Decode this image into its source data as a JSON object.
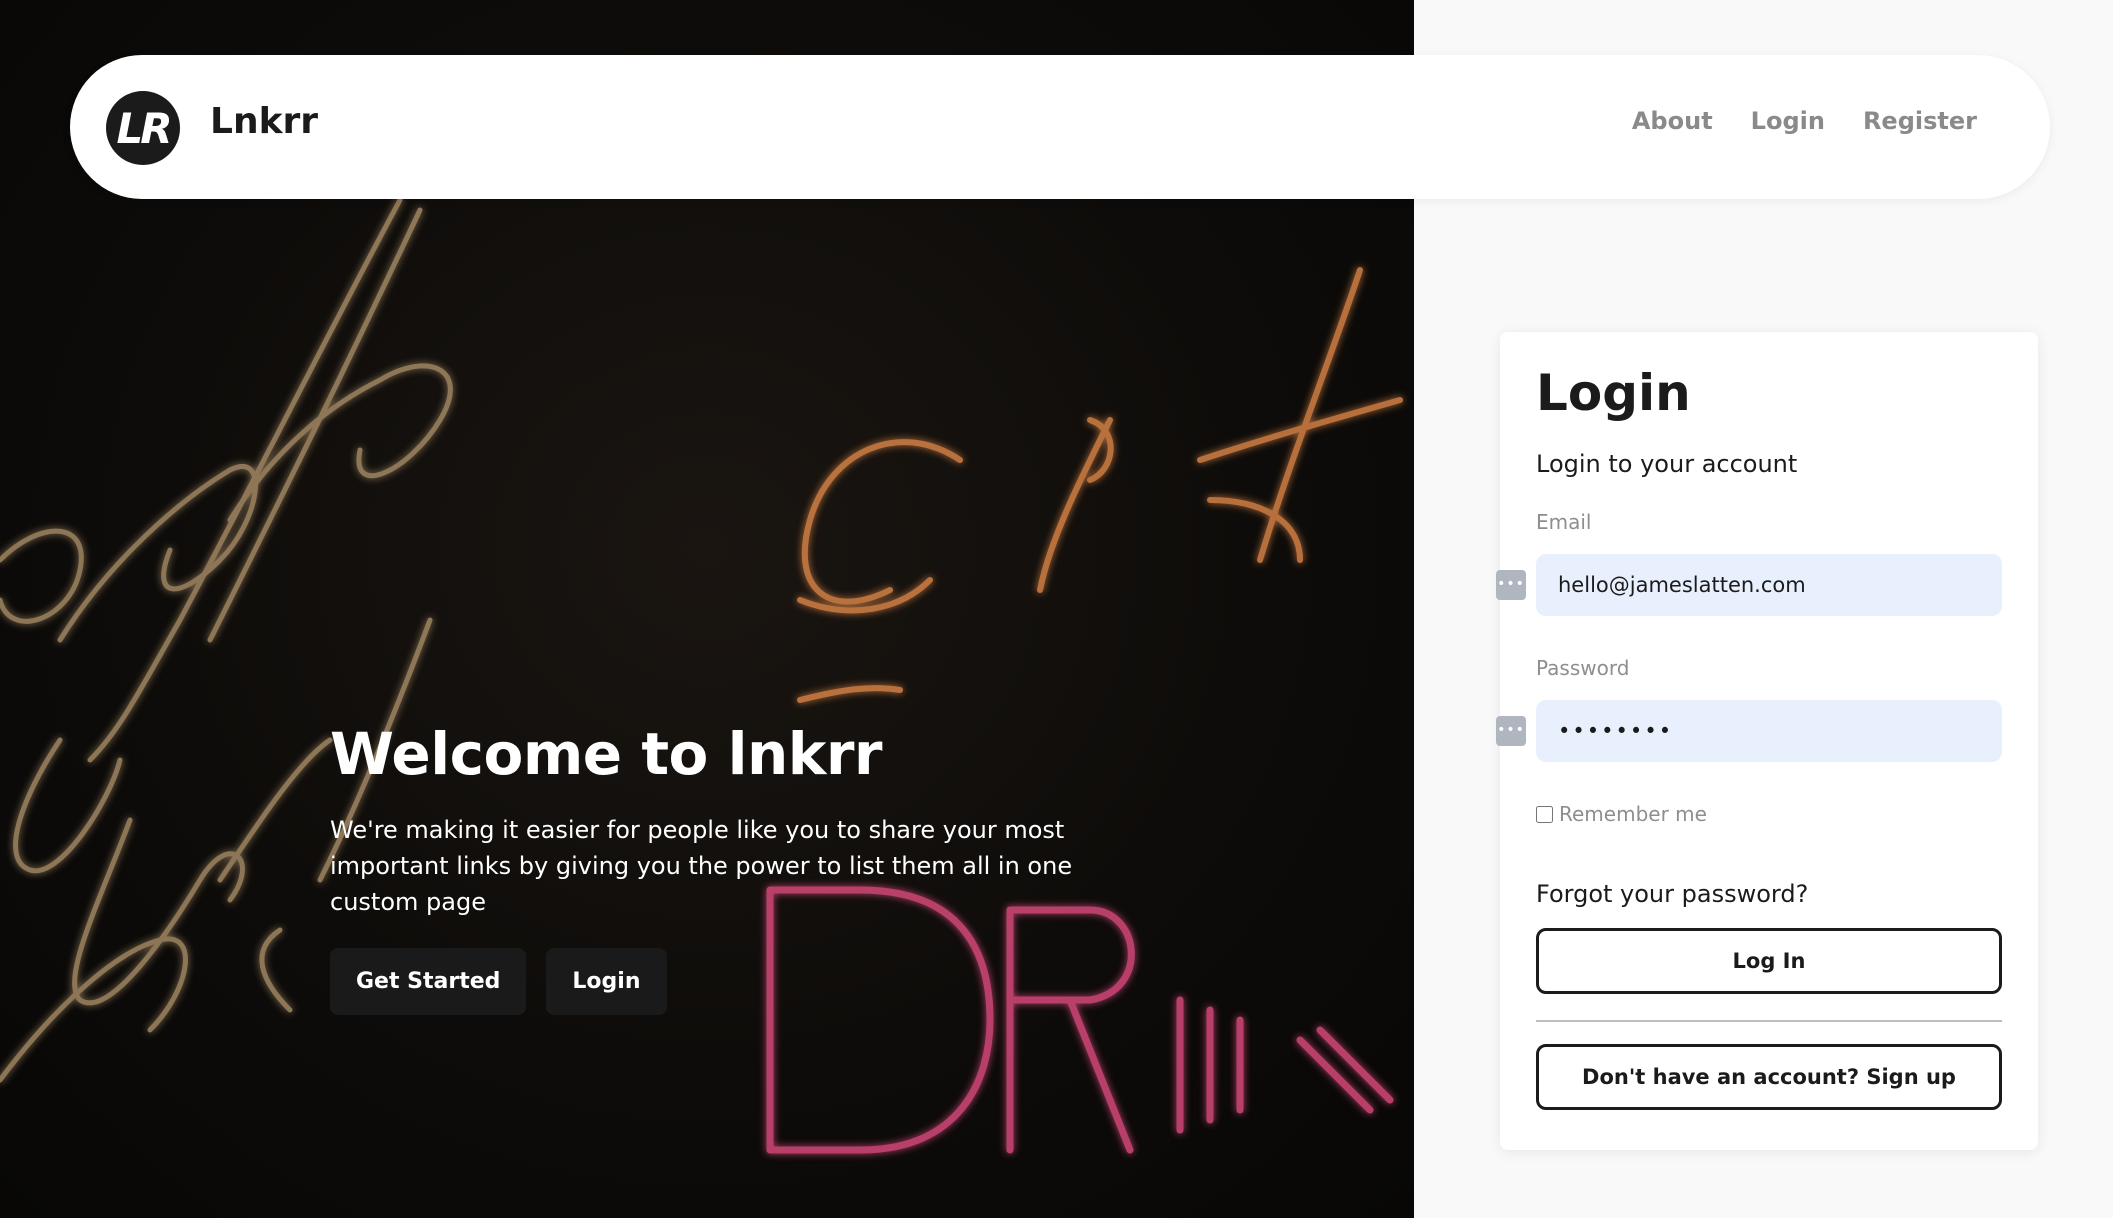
{
  "navbar": {
    "logo_text": "LR",
    "brand": "Lnkrr",
    "links": [
      {
        "label": "About"
      },
      {
        "label": "Login"
      },
      {
        "label": "Register"
      }
    ]
  },
  "hero": {
    "title": "Welcome to lnkrr",
    "description": "We're making it easier for people like you to share your most important links by giving you the power to list them all in one custom page",
    "buttons": {
      "get_started": "Get Started",
      "login": "Login"
    }
  },
  "login_card": {
    "title": "Login",
    "subtitle": "Login to your account",
    "email": {
      "label": "Email",
      "value": "hello@jameslatten.com"
    },
    "password": {
      "label": "Password",
      "value": "••••••••"
    },
    "remember_me": "Remember me",
    "forgot_password": "Forgot your password?",
    "login_button": "Log In",
    "signup_button": "Don't have an account? Sign up"
  },
  "icons": {
    "autofill": "key-autofill-icon"
  },
  "colors": {
    "hero_background": "#0e0c0a",
    "neon_orange": "#e28a4a",
    "neon_tan": "#b89a70",
    "neon_pink": "#d64a7a",
    "input_background": "#e8f0fe",
    "page_background": "#f9f9f9"
  }
}
